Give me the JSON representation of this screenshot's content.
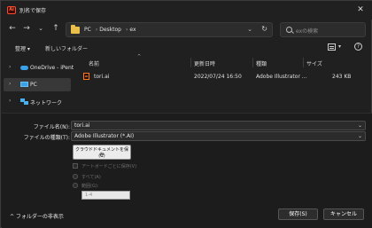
{
  "window": {
    "app_icon_text": "Ai",
    "title": "別名で保存",
    "close_glyph": "✕"
  },
  "nav": {
    "back_glyph": "←",
    "forward_glyph": "→",
    "dropdown_glyph": "⌄",
    "up_glyph": "↑"
  },
  "address": {
    "crumbs": [
      "PC",
      "Desktop",
      "ex"
    ],
    "separator": "›",
    "chevron": "⌄",
    "refresh_glyph": "↻"
  },
  "search": {
    "placeholder": "exの検索"
  },
  "toolbar": {
    "organize": "整理 ▾",
    "new_folder": "新しいフォルダー",
    "view_chevron": "▾",
    "help": "?"
  },
  "sidebar": {
    "items": [
      {
        "label": "OneDrive - iPent",
        "icon": "cloud-icon",
        "selected": false
      },
      {
        "label": "PC",
        "icon": "pc-icon",
        "selected": true
      },
      {
        "label": "ネットワーク",
        "icon": "network-icon",
        "selected": false
      }
    ],
    "chevron": "›"
  },
  "file_list": {
    "columns": [
      "名前",
      "更新日時",
      "種類",
      "サイズ"
    ],
    "sort_glyph": "^",
    "rows": [
      {
        "icon": "illustrator-file-icon",
        "icon_text": "Ai",
        "name": "tori.ai",
        "modified": "2022/07/24 16:50",
        "type": "Adobe Illustrator ...",
        "size": "243 KB"
      }
    ]
  },
  "form": {
    "filename_label": "ファイル名(N):",
    "filename_value": "tori.ai",
    "filetype_label": "ファイルの種類(T):",
    "filetype_value": "Adobe Illustrator (*.AI)",
    "chevron": "⌄",
    "cloud_button_line1": "クラウドドキュメントを保存",
    "cloud_button_line2": "(C)",
    "artboard_option": "アートボードごとに保存(V)",
    "all_option": "すべて(A)",
    "range_option": "範囲(G):",
    "range_value": "1-4"
  },
  "footer": {
    "hide_folders": "^  フォルダーの非表示",
    "save": "保存(S)",
    "cancel": "キャンセル"
  },
  "colors": {
    "background": "#202020",
    "accent_folder": "#e9bf4a",
    "accent_blue": "#3aa0e8",
    "illustrator_orange": "#ff7a1a"
  }
}
